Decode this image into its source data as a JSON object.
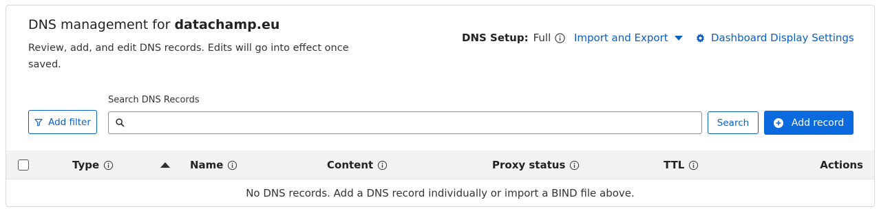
{
  "header": {
    "title_prefix": "DNS management for",
    "domain": "datachamp.eu",
    "subtitle": "Review, add, and edit DNS records. Edits will go into effect once saved."
  },
  "dns_setup": {
    "label": "DNS Setup:",
    "value": "Full"
  },
  "links": {
    "import_export": "Import and Export",
    "dashboard_settings": "Dashboard Display Settings"
  },
  "toolbar": {
    "add_filter": "Add filter",
    "search_label": "Search DNS Records",
    "search_value": "",
    "search_button": "Search",
    "add_record": "Add record"
  },
  "table": {
    "columns": [
      "Type",
      "Name",
      "Content",
      "Proxy status",
      "TTL",
      "Actions"
    ],
    "empty_message": "No DNS records. Add a DNS record individually or import a BIND file above."
  },
  "colors": {
    "accent": "#0a5fc4",
    "primary_button": "#0b6bde",
    "header_bg": "#f2f2f2"
  }
}
